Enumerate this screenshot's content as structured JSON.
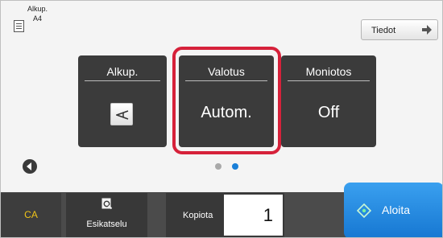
{
  "header": {
    "original_label": "Alkup.",
    "original_size": "A4",
    "info_button_label": "Tiedot"
  },
  "settings_cards": [
    {
      "title": "Alkup.",
      "value": ""
    },
    {
      "title": "Valotus",
      "value": "Autom."
    },
    {
      "title": "Moniotos",
      "value": "Off"
    }
  ],
  "pager": {
    "page_count": 2,
    "active_page": 2
  },
  "footer": {
    "ca_label": "CA",
    "preview_label": "Esikatselu",
    "copies_label": "Kopiota",
    "copies_value": "1",
    "start_label": "Aloita"
  },
  "colors": {
    "highlight": "#d6213a",
    "start_button": "#1f86e0",
    "ca_text": "#f0c419",
    "active_dot": "#1a7fd8"
  }
}
